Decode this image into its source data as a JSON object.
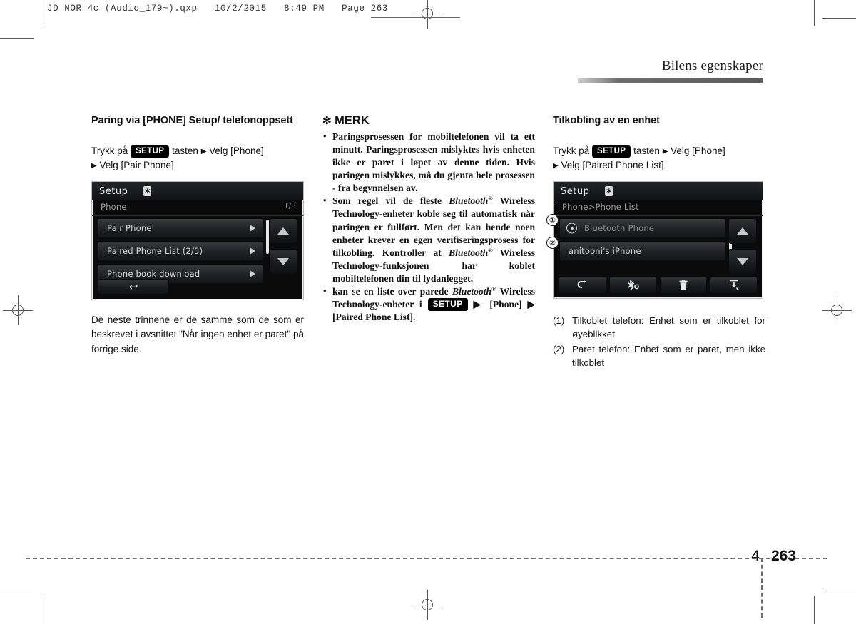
{
  "file_header": "JD NOR 4c (Audio_179~).qxp   10/2/2015   8:49 PM   Page 263",
  "running_head": "Bilens egenskaper",
  "page": {
    "chapter": "4",
    "number": "263"
  },
  "left_column": {
    "heading": "Paring via [PHONE] Setup/ telefonoppsett",
    "instruction_pre": "Trykk på",
    "key_label": "SETUP",
    "instruction_post": "tasten",
    "instruction_step1": "Velg [Phone]",
    "instruction_step2": "Velg [Pair Phone]",
    "screenshot": {
      "title": "Setup",
      "bt_icon": "bluetooth-icon",
      "breadcrumb": "Phone",
      "page_indicator": "1/3",
      "rows": [
        {
          "label": "Pair Phone"
        },
        {
          "label": "Paired Phone List  (2/5)"
        },
        {
          "label": "Phone book download"
        }
      ],
      "back_icon": "back-arrow-icon",
      "scroll_up_icon": "triangle-up-icon",
      "scroll_down_icon": "triangle-down-icon"
    },
    "body": "De neste trinnene er de samme som de som er beskrevet i avsnittet \"Når ingen enhet er paret\" på forrige side."
  },
  "middle_column": {
    "note_title": "MERK",
    "note_star": "✻",
    "bullets": [
      {
        "parts": [
          {
            "t": "Paringsprosessen for mobiltelefonen vil ta ett minutt. Paringsprosessen mislyktes hvis enheten ikke er paret i løpet av denne tiden. Hvis paringen mislykkes, må du gjenta hele prosessen - fra begynnelsen av."
          }
        ]
      },
      {
        "parts": [
          {
            "t": "Som regel vil de fleste "
          },
          {
            "t": "Bluetooth",
            "style": "italic"
          },
          {
            "t": "®",
            "style": "sup"
          },
          {
            "t": " Wireless Technology-enheter koble seg til automatisk når paringen er fullført. Men det kan hende noen enheter krever en egen verifiseringsprosess for tilkobling. Kontroller at "
          },
          {
            "t": "Bluetooth",
            "style": "italic"
          },
          {
            "t": "®",
            "style": "sup"
          },
          {
            "t": " Wireless Technology-funksjonen har koblet mobiltelefonen din til lydanlegget."
          }
        ]
      },
      {
        "parts": [
          {
            "t": "kan se en liste over parede "
          },
          {
            "t": "Bluetooth",
            "style": "italic"
          },
          {
            "t": "®",
            "style": "sup"
          },
          {
            "t": " Wireless Technology-enheter i "
          },
          {
            "t": "SETUP",
            "style": "key"
          },
          {
            "t": " ▶ [Phone] ▶ [Paired Phone List]."
          }
        ]
      }
    ]
  },
  "right_column": {
    "heading": "Tilkobling av en enhet",
    "instruction_pre": "Trykk på",
    "key_label": "SETUP",
    "instruction_post": "tasten",
    "instruction_step1": "Velg [Phone]",
    "instruction_step2": "Velg [Paired Phone List]",
    "screenshot": {
      "title": "Setup",
      "bt_icon": "bluetooth-icon",
      "breadcrumb": "Phone>Phone List",
      "rows": [
        {
          "label": "Bluetooth Phone",
          "icon": "play-circle-icon",
          "callout": "①"
        },
        {
          "label": "anitooni's iPhone",
          "callout": "②"
        }
      ],
      "toolbar": [
        {
          "icon": "back-arrow-icon"
        },
        {
          "icon": "bluetooth-connect-icon"
        },
        {
          "icon": "trash-icon"
        },
        {
          "icon": "download-icon"
        }
      ],
      "scroll_up_icon": "triangle-up-icon",
      "scroll_down_icon": "triangle-down-icon"
    },
    "legend": [
      {
        "num": "(1)",
        "text": "Tilkoblet telefon: Enhet som er tilkoblet for øyeblikket"
      },
      {
        "num": "(2)",
        "text": "Paret telefon: Enhet som er paret, men ikke tilkoblet"
      }
    ]
  },
  "colors": {
    "accent_bar": "#5a5a5a",
    "key_badge_bg": "#000000",
    "device_bg": "#0b0b0c"
  }
}
